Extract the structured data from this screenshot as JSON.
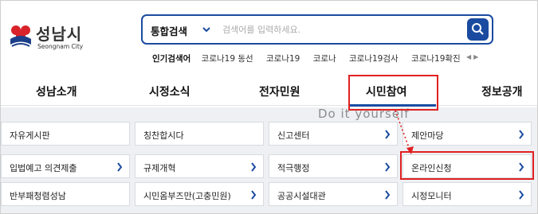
{
  "logo": {
    "name_ko": "성남시",
    "name_en": "Seongnam City"
  },
  "search": {
    "scope": "통합검색",
    "placeholder": "검색어를 입력하세요."
  },
  "popular": {
    "label": "인기검색어",
    "items": [
      "코로나19 동선",
      "코로나19",
      "코로나",
      "코로나19검사",
      "코로나19확진"
    ]
  },
  "nav": [
    "성남소개",
    "시정소식",
    "전자민원",
    "시민참여",
    "정보공개"
  ],
  "watermark": "Do it yourself",
  "submenu": [
    [
      "자유게시판",
      "칭찬합시다",
      "신고센터",
      "제안마당"
    ],
    [
      "입법예고 의견제출",
      "규제개혁",
      "적극행정",
      "온라인신청"
    ],
    [
      "반부패청렴성남",
      "시민옴부즈만(고충민원)",
      "공공시설대관",
      "시정모니터"
    ]
  ],
  "colors": {
    "accent": "#1a4ba0",
    "highlight": "#e02020"
  }
}
